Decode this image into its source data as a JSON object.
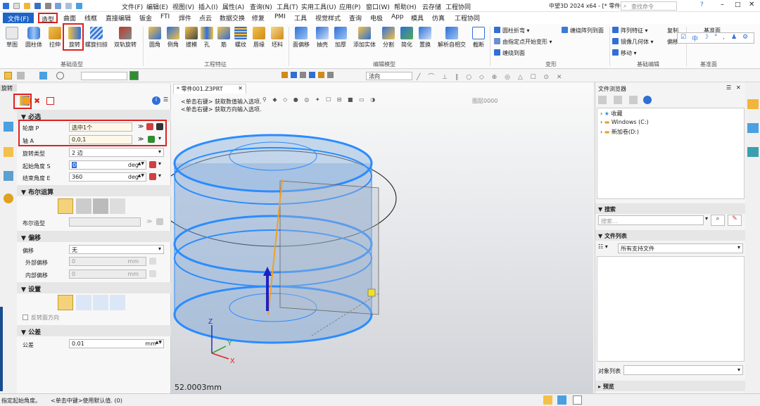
{
  "title_bar": {
    "title": "中望3D 2024 x64 - [* 零件001.Z3PRT]",
    "file_menu": "文件(F)",
    "search_placeholder": "查找命令"
  },
  "menubar": {
    "items": [
      "文件(F)",
      "造型",
      "曲面",
      "线框",
      "直接编辑",
      "钣金",
      "FTI",
      "焊件",
      "点云",
      "数据交换",
      "修复",
      "PMI",
      "工具",
      "视觉样式",
      "查询",
      "电极",
      "App",
      "模具",
      "仿真",
      "工程协同"
    ],
    "top_menu": [
      "编辑(E)",
      "视图(V)",
      "插入(I)",
      "属性(A)",
      "查询(N)",
      "工具(T)",
      "实用工具(U)",
      "应用(P)",
      "窗口(W)",
      "帮助(H)",
      "云存储",
      "工程协同"
    ]
  },
  "ribbon": {
    "basic_buttons": [
      "草图",
      "圆柱体",
      "拉伸",
      "旋转",
      "螺旋扫掠",
      "双轨旋转"
    ],
    "basic_group": "基础造型",
    "feature_buttons": [
      "圆角",
      "倒角",
      "拔模",
      "孔",
      "筋",
      "螺纹",
      "唇缘",
      "坯料"
    ],
    "feature_group": "工程特征",
    "edit_buttons": [
      "面偏移",
      "抽壳",
      "加厚",
      "添加实体",
      "分割",
      "简化",
      "置换",
      "解析自相交",
      "截断"
    ],
    "edit_group": "编辑模型",
    "deform_links": [
      "圆柱折弯",
      "由指定点开始变形",
      "缠绕到面"
    ],
    "deform_extra": "缠绕阵列到面",
    "deform_group": "变形",
    "basic_edit_links": [
      "阵列特征",
      "镜像几何体",
      "移动"
    ],
    "basic_edit_group": "基础编辑",
    "datum_group": "基准面",
    "extra_labels": [
      "复制",
      "偏移",
      "基准面"
    ]
  },
  "toolbar2": {
    "dropdown": "法向"
  },
  "panel": {
    "title": "旋转",
    "sections": {
      "required": "必选",
      "boolean": "布尔运算",
      "offset": "偏移",
      "settings": "设置",
      "tolerance": "公差"
    },
    "fields": {
      "profile_label": "轮廓 P",
      "profile_value": "选中1个",
      "axis_label": "轴 A",
      "axis_value": "0,0,1",
      "rotate_type_label": "旋转类型",
      "rotate_type_value": "2 边",
      "start_angle_label": "起始角度 S",
      "start_angle_value": "0",
      "start_angle_unit": "deg",
      "end_angle_label": "结束角度 E",
      "end_angle_value": "360",
      "end_angle_unit": "deg",
      "boolean_shape_label": "布尔造型",
      "offset_label": "偏移",
      "offset_value": "无",
      "outer_offset_label": "外部偏移",
      "outer_offset_value": "0",
      "outer_offset_unit": "mm",
      "inner_offset_label": "内部偏移",
      "inner_offset_value": "0",
      "inner_offset_unit": "mm",
      "reverse_label": "反转面方向",
      "tolerance_label": "公差",
      "tolerance_value": "0.01",
      "tolerance_unit": "mm"
    }
  },
  "document": {
    "tab_label": "* 零件001.Z3PRT",
    "hint_line1": "<单击右键> 获取数值输入选项.",
    "hint_line2": "<单击右键> 获取方向输入选项.",
    "layer": "图层0000",
    "measure": "52.0003mm",
    "axis_x": "X",
    "axis_y": "Y",
    "axis_z": "Z"
  },
  "browser": {
    "title": "文件浏览器",
    "tree": [
      "收藏",
      "Windows (C:)",
      "新加卷(D:)"
    ],
    "search_section": "搜索",
    "search_placeholder": "搜索...",
    "file_list_section": "文件列表",
    "file_filter": "所有支持文件",
    "object_list_label": "对象列表",
    "preview_section": "预览"
  },
  "statusbar": {
    "left_text": "指定起始角度。",
    "hint_text": "<单击中键>使用默认值. (0)"
  },
  "colors": {
    "accent_blue": "#1e88e5",
    "highlight_red": "#e02020",
    "model_blue": "#2a8cff"
  }
}
